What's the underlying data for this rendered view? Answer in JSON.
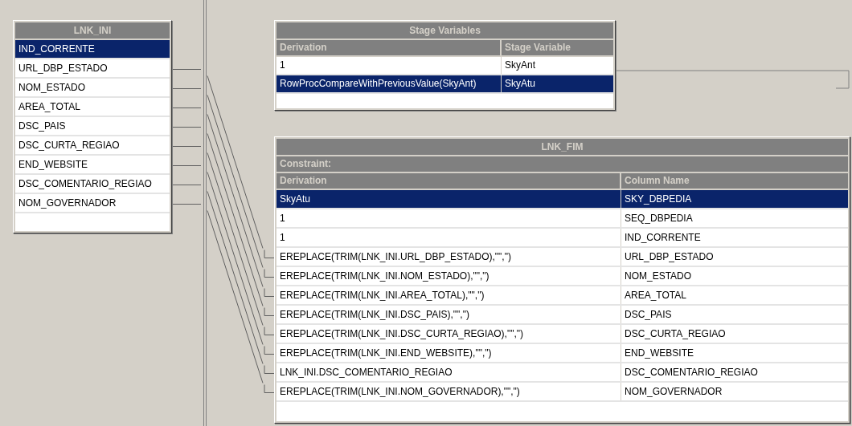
{
  "input_link": {
    "title": "LNK_INI",
    "rows": [
      {
        "name": "IND_CORRENTE",
        "selected": true,
        "linked": false
      },
      {
        "name": "URL_DBP_ESTADO",
        "selected": false,
        "linked": true
      },
      {
        "name": "NOM_ESTADO",
        "selected": false,
        "linked": true
      },
      {
        "name": "AREA_TOTAL",
        "selected": false,
        "linked": true
      },
      {
        "name": "DSC_PAIS",
        "selected": false,
        "linked": true
      },
      {
        "name": "DSC_CURTA_REGIAO",
        "selected": false,
        "linked": true
      },
      {
        "name": "END_WEBSITE",
        "selected": false,
        "linked": true
      },
      {
        "name": "DSC_COMENTARIO_REGIAO",
        "selected": false,
        "linked": true
      },
      {
        "name": "NOM_GOVERNADOR",
        "selected": false,
        "linked": true
      }
    ]
  },
  "stage_variables": {
    "title": "Stage Variables",
    "columns": [
      "Derivation",
      "Stage Variable"
    ],
    "rows": [
      {
        "derivation": "1",
        "variable": "SkyAnt",
        "selected": false
      },
      {
        "derivation": "RowProcCompareWithPreviousValue(SkyAnt)",
        "variable": "SkyAtu",
        "selected": true
      }
    ]
  },
  "output_link": {
    "title": "LNK_FIM",
    "constraint_label": "Constraint:",
    "columns": [
      "Derivation",
      "Column Name"
    ],
    "rows": [
      {
        "derivation": "SkyAtu",
        "column": "SKY_DBPEDIA",
        "selected": true,
        "linked": false
      },
      {
        "derivation": "1",
        "column": "SEQ_DBPEDIA",
        "selected": false,
        "linked": false
      },
      {
        "derivation": "1",
        "column": "IND_CORRENTE",
        "selected": false,
        "linked": false
      },
      {
        "derivation": "EREPLACE(TRIM(LNK_INI.URL_DBP_ESTADO),\"\",\")",
        "column": "URL_DBP_ESTADO",
        "selected": false,
        "linked": true
      },
      {
        "derivation": "EREPLACE(TRIM(LNK_INI.NOM_ESTADO),\"\",\")",
        "column": "NOM_ESTADO",
        "selected": false,
        "linked": true
      },
      {
        "derivation": "EREPLACE(TRIM(LNK_INI.AREA_TOTAL),\"\",\")",
        "column": "AREA_TOTAL",
        "selected": false,
        "linked": true
      },
      {
        "derivation": "EREPLACE(TRIM(LNK_INI.DSC_PAIS),\"\",\")",
        "column": "DSC_PAIS",
        "selected": false,
        "linked": true
      },
      {
        "derivation": "EREPLACE(TRIM(LNK_INI.DSC_CURTA_REGIAO),\"\",\")",
        "column": "DSC_CURTA_REGIAO",
        "selected": false,
        "linked": true
      },
      {
        "derivation": "EREPLACE(TRIM(LNK_INI.END_WEBSITE),\"\",\")",
        "column": "END_WEBSITE",
        "selected": false,
        "linked": true
      },
      {
        "derivation": "LNK_INI.DSC_COMENTARIO_REGIAO",
        "column": "DSC_COMENTARIO_REGIAO",
        "selected": false,
        "linked": true
      },
      {
        "derivation": "EREPLACE(TRIM(LNK_INI.NOM_GOVERNADOR),\"\",\")",
        "column": "NOM_GOVERNADOR",
        "selected": false,
        "linked": true
      }
    ]
  }
}
